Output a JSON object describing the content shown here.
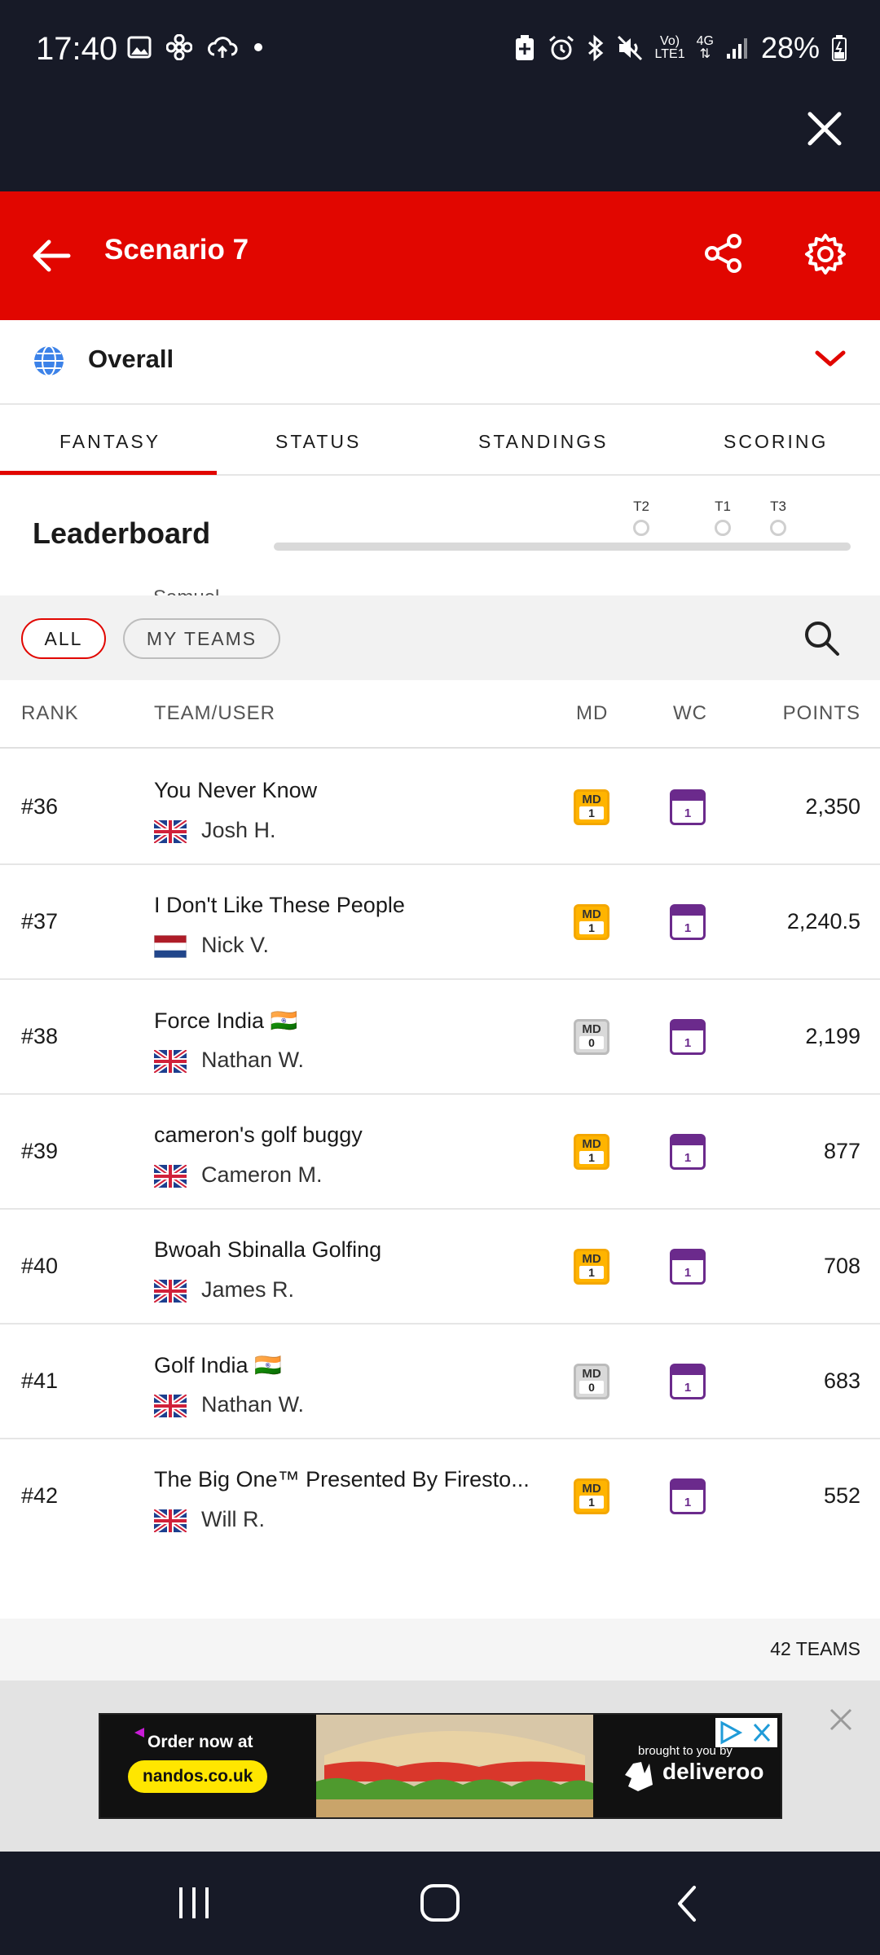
{
  "status_bar": {
    "time": "17:40",
    "volte": "Vo)",
    "lte": "LTE1",
    "net": "4G",
    "battery": "28%"
  },
  "header": {
    "title": "Scenario 7"
  },
  "scope": {
    "label": "Overall"
  },
  "tabs": [
    {
      "label": "FANTASY"
    },
    {
      "label": "STATUS"
    },
    {
      "label": "STANDINGS"
    },
    {
      "label": "SCORING"
    }
  ],
  "leaderboard": {
    "title": "Leaderboard",
    "markers": [
      "T2",
      "T1",
      "T3"
    ],
    "peek_text": "Samuel"
  },
  "filters": {
    "all": "ALL",
    "my_teams": "MY TEAMS"
  },
  "columns": {
    "rank": "RANK",
    "team_user": "TEAM/USER",
    "md": "MD",
    "wc": "WC",
    "points": "POINTS"
  },
  "chip_labels": {
    "md": "MD"
  },
  "rows": [
    {
      "rank": "#36",
      "team": "You Never Know",
      "user": "Josh H.",
      "md": "1",
      "wc": "1",
      "points": "2,350"
    },
    {
      "rank": "#37",
      "team": "I Don't Like These People",
      "user": "Nick V.",
      "md": "1",
      "wc": "1",
      "points": "2,240.5"
    },
    {
      "rank": "#38",
      "team": "Force India 🇮🇳",
      "user": "Nathan W.",
      "md": "0",
      "wc": "1",
      "points": "2,199"
    },
    {
      "rank": "#39",
      "team": "cameron's golf buggy",
      "user": "Cameron M.",
      "md": "1",
      "wc": "1",
      "points": "877"
    },
    {
      "rank": "#40",
      "team": "Bwoah Sbinalla Golfing",
      "user": "James R.",
      "md": "1",
      "wc": "1",
      "points": "708"
    },
    {
      "rank": "#41",
      "team": "Golf India 🇮🇳",
      "user": "Nathan W.",
      "md": "0",
      "wc": "1",
      "points": "683"
    },
    {
      "rank": "#42",
      "team": "The Big One™ Presented By Firesto...",
      "user": "Will R.",
      "md": "1",
      "wc": "1",
      "points": "552"
    }
  ],
  "team_count": "42 TEAMS",
  "ad": {
    "order_text": "Order now at",
    "url_text": "nandos.co.uk",
    "brought_text": "brought to you by",
    "brand_text": "deliveroo"
  }
}
